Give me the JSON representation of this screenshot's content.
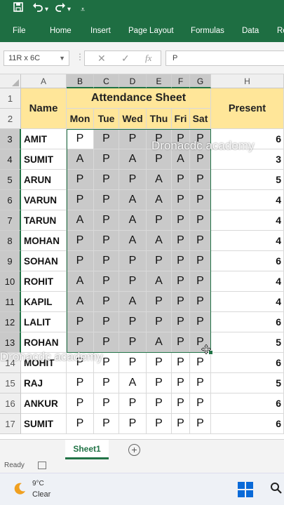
{
  "quick_access": {
    "save_icon": "save-icon",
    "undo_icon": "undo-icon",
    "redo_icon": "redo-icon",
    "customize_icon": "customize-icon"
  },
  "ribbon": {
    "tabs": [
      "File",
      "Home",
      "Insert",
      "Page Layout",
      "Formulas",
      "Data",
      "Re"
    ]
  },
  "formula_bar": {
    "name_box": "11R x 6C",
    "cancel": "✕",
    "enter": "✓",
    "fx": "fx",
    "value": "P"
  },
  "columns": [
    "A",
    "B",
    "C",
    "D",
    "E",
    "F",
    "G",
    "H"
  ],
  "rows": [
    "1",
    "2",
    "3",
    "4",
    "5",
    "6",
    "7",
    "8",
    "9",
    "10",
    "11",
    "12",
    "13",
    "14",
    "15",
    "16",
    "17"
  ],
  "sheet": {
    "name_header": "Name",
    "title": "Attendance Sheet",
    "present_header": "Present",
    "days": [
      "Mon",
      "Tue",
      "Wed",
      "Thu",
      "Fri",
      "Sat"
    ],
    "students": [
      {
        "name": "AMIT",
        "marks": [
          "P",
          "P",
          "P",
          "P",
          "P",
          "P"
        ],
        "present": "6"
      },
      {
        "name": "SUMIT",
        "marks": [
          "A",
          "P",
          "A",
          "P",
          "A",
          "P"
        ],
        "present": "3"
      },
      {
        "name": "ARUN",
        "marks": [
          "P",
          "P",
          "P",
          "A",
          "P",
          "P"
        ],
        "present": "5"
      },
      {
        "name": "VARUN",
        "marks": [
          "P",
          "P",
          "A",
          "A",
          "P",
          "P"
        ],
        "present": "4"
      },
      {
        "name": "TARUN",
        "marks": [
          "A",
          "P",
          "A",
          "P",
          "P",
          "P"
        ],
        "present": "4"
      },
      {
        "name": "MOHAN",
        "marks": [
          "P",
          "P",
          "A",
          "A",
          "P",
          "P"
        ],
        "present": "4"
      },
      {
        "name": "SOHAN",
        "marks": [
          "P",
          "P",
          "P",
          "P",
          "P",
          "P"
        ],
        "present": "6"
      },
      {
        "name": "ROHIT",
        "marks": [
          "A",
          "P",
          "P",
          "A",
          "P",
          "P"
        ],
        "present": "4"
      },
      {
        "name": "KAPIL",
        "marks": [
          "A",
          "P",
          "A",
          "P",
          "P",
          "P"
        ],
        "present": "4"
      },
      {
        "name": "LALIT",
        "marks": [
          "P",
          "P",
          "P",
          "P",
          "P",
          "P"
        ],
        "present": "6"
      },
      {
        "name": "ROHAN",
        "marks": [
          "P",
          "P",
          "P",
          "A",
          "P",
          "P"
        ],
        "present": "5"
      },
      {
        "name": "MOHIT",
        "marks": [
          "P",
          "P",
          "P",
          "P",
          "P",
          "P"
        ],
        "present": "6"
      },
      {
        "name": "RAJ",
        "marks": [
          "P",
          "P",
          "A",
          "P",
          "P",
          "P"
        ],
        "present": "5"
      },
      {
        "name": "ANKUR",
        "marks": [
          "P",
          "P",
          "P",
          "P",
          "P",
          "P"
        ],
        "present": "6"
      },
      {
        "name": "SUMIT",
        "marks": [
          "P",
          "P",
          "P",
          "P",
          "P",
          "P"
        ],
        "present": "6"
      }
    ]
  },
  "watermarks": [
    "Dronacdc academy",
    "Dronacdc academy"
  ],
  "sheet_tabs": {
    "active": "Sheet1",
    "add_icon": "+"
  },
  "status_bar": {
    "status": "Ready"
  },
  "taskbar": {
    "temperature": "9°C",
    "condition": "Clear"
  },
  "colors": {
    "excel_green": "#1e6e42",
    "header_yellow": "#ffe699",
    "selection_gray": "#c9c9c9",
    "selection_border": "#217346"
  }
}
